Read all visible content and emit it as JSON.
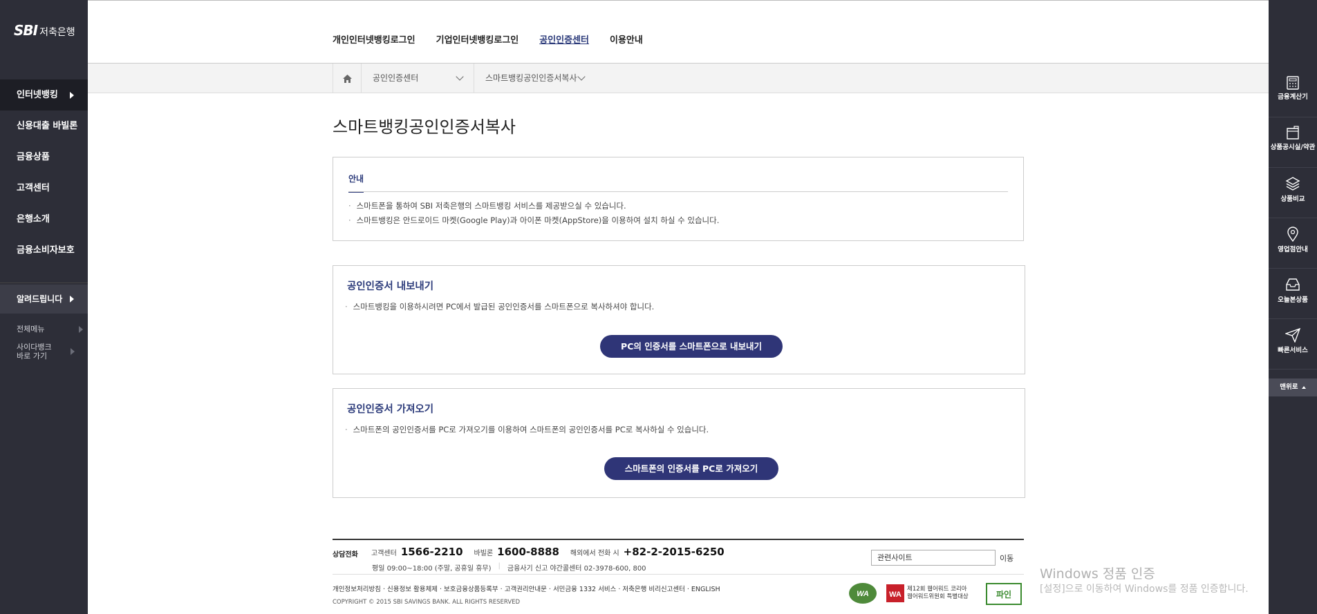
{
  "brand": {
    "logo_mark": "SBI",
    "logo_text": "저축은행"
  },
  "sidebar": {
    "items": [
      {
        "label": "인터넷뱅킹"
      },
      {
        "label": "신용대출 바빌론"
      },
      {
        "label": "금융상품"
      },
      {
        "label": "고객센터"
      },
      {
        "label": "은행소개"
      },
      {
        "label": "금융소비자보호"
      }
    ],
    "notice_label": "알려드립니다",
    "all_menu_label": "전체메뉴",
    "cyber_bank_label": "사이다뱅크 바로 가기"
  },
  "gnb": {
    "items": [
      {
        "label": "개인인터넷뱅킹로그인"
      },
      {
        "label": "기업인터넷뱅킹로그인"
      },
      {
        "label": "공인인증센터"
      },
      {
        "label": "이용안내"
      }
    ]
  },
  "breadcrumb": {
    "level1": "공인인증센터",
    "level2": "스마트뱅킹공인인증서복사"
  },
  "page": {
    "title": "스마트뱅킹공인인증서복사",
    "info": {
      "tab": "안내",
      "bullets": [
        "스마트폰을 통하여 SBI 저축은행의 스마트뱅킹 서비스를 제공받으실 수 있습니다.",
        "스마트뱅킹은 안드로이드 마켓(Google Play)과 아이폰 마켓(AppStore)을 이용하여 설치 하실 수 있습니다."
      ]
    },
    "export": {
      "title": "공인인증서 내보내기",
      "desc": "스마트뱅킹을 이용하시려면 PC에서 발급된 공인인증서를 스마트폰으로 복사하셔야 합니다.",
      "button": "PC의 인증서를 스마트폰으로 내보내기"
    },
    "import": {
      "title": "공인인증서 가져오기",
      "desc": "스마트폰의 공인인증서를 PC로 가져오기를 이용하여 스마트폰의 공인인증서를 PC로 복사하실 수 있습니다.",
      "button": "스마트폰의 인증서를 PC로 가져오기"
    }
  },
  "footer": {
    "consult_label": "상담전화",
    "center_label": "고객센터",
    "center_number": "1566-2210",
    "babylon_label": "바빌론",
    "babylon_number": "1600-8888",
    "overseas_label": "해외에서 전화 시",
    "overseas_number": "+82-2-2015-6250",
    "hours": "평일 09:00~18:00 (주말, 공휴일 휴무)",
    "fraud": "금융사기 신고 야간콜센터 02-3978-600, 800",
    "links": "개인정보처리방침 · 신용정보 활용체제 · 보호금융상품등록부 · 고객권리안내문 · 서민금융 1332 서비스 · 저축은행 비리신고센터 · ENGLISH",
    "copyright": "COPYRIGHT © 2015 SBI SAVINGS BANK. ALL RIGHTS RESERVED",
    "related_site": "관련사이트",
    "go_label": "이동",
    "award_text_1": "제12회 웹어워드 코리아",
    "award_text_2": "웹어워드위원회 특별대상",
    "badge_pain": "파인"
  },
  "watermark": {
    "line1": "Windows 정품 인증",
    "line2": "[설정]으로 이동하여 Windows를 정품 인증합니다."
  },
  "quickbar": {
    "items": [
      {
        "label": "금융계산기",
        "icon": "calculator-icon"
      },
      {
        "label": "상품공시실/약관",
        "icon": "document-icon"
      },
      {
        "label": "상품비교",
        "icon": "layers-icon"
      },
      {
        "label": "영업점안내",
        "icon": "location-pin-icon"
      },
      {
        "label": "오늘본상품",
        "icon": "inbox-icon"
      },
      {
        "label": "빠른서비스",
        "icon": "paper-plane-icon"
      }
    ],
    "top_label": "맨위로"
  },
  "colors": {
    "sidebar_bg": "#2d2e38",
    "accent": "#2b3a7a",
    "button": "#2f3577"
  }
}
